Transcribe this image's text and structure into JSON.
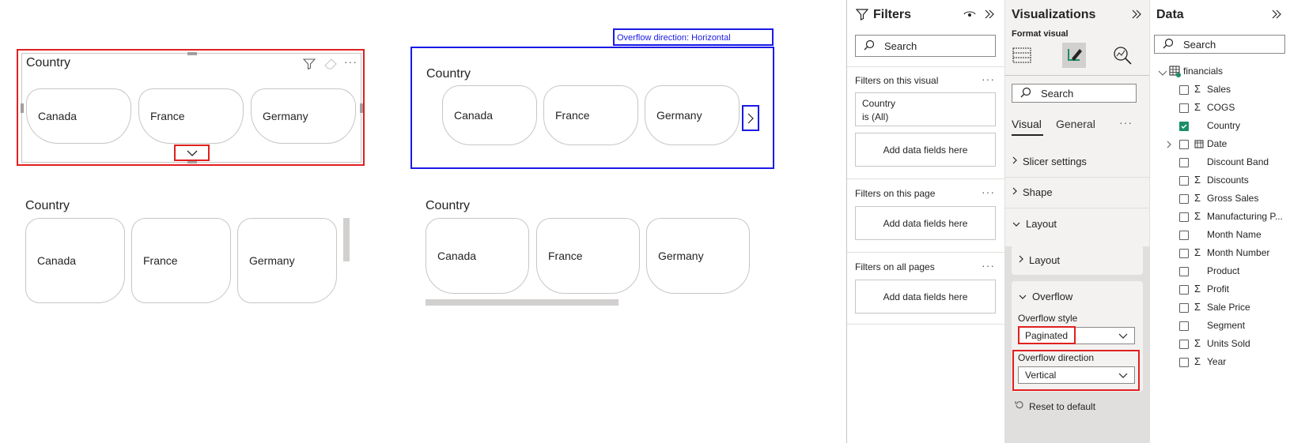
{
  "canvas": {
    "slicer1": {
      "title": "Country",
      "items": [
        "Canada",
        "France",
        "Germany"
      ]
    },
    "slicer2": {
      "title": "Country",
      "items": [
        "Canada",
        "France",
        "Germany"
      ],
      "annotation": "Overflow direction: Horizontal"
    },
    "slicer3": {
      "title": "Country",
      "items": [
        "Canada",
        "France",
        "Germany"
      ]
    },
    "slicer4": {
      "title": "Country",
      "items": [
        "Canada",
        "France",
        "Germany"
      ]
    }
  },
  "filters": {
    "title": "Filters",
    "search_placeholder": "Search",
    "on_visual_label": "Filters on this visual",
    "country_filter_name": "Country",
    "country_filter_value": "is (All)",
    "add_fields": "Add data fields here",
    "on_page_label": "Filters on this page",
    "on_all_pages_label": "Filters on all pages"
  },
  "visualizations": {
    "title": "Visualizations",
    "format_visual": "Format visual",
    "search_placeholder": "Search",
    "tab_visual": "Visual",
    "tab_general": "General",
    "slicer_settings": "Slicer settings",
    "shape": "Shape",
    "layout": "Layout",
    "layout_sub": "Layout",
    "overflow": "Overflow",
    "overflow_style_label": "Overflow style",
    "overflow_style_value": "Paginated",
    "overflow_direction_label": "Overflow direction",
    "overflow_direction_value": "Vertical",
    "reset": "Reset to default"
  },
  "data": {
    "title": "Data",
    "search_placeholder": "Search",
    "table_name": "financials",
    "fields": [
      {
        "name": "Sales",
        "sigma": true,
        "checked": false
      },
      {
        "name": "COGS",
        "sigma": true,
        "checked": false
      },
      {
        "name": "Country",
        "sigma": false,
        "checked": true
      },
      {
        "name": "Date",
        "sigma": false,
        "checked": false,
        "hierarchy": true
      },
      {
        "name": "Discount Band",
        "sigma": false,
        "checked": false
      },
      {
        "name": "Discounts",
        "sigma": true,
        "checked": false
      },
      {
        "name": "Gross Sales",
        "sigma": true,
        "checked": false
      },
      {
        "name": "Manufacturing P...",
        "sigma": true,
        "checked": false
      },
      {
        "name": "Month Name",
        "sigma": false,
        "checked": false
      },
      {
        "name": "Month Number",
        "sigma": true,
        "checked": false
      },
      {
        "name": "Product",
        "sigma": false,
        "checked": false
      },
      {
        "name": "Profit",
        "sigma": true,
        "checked": false
      },
      {
        "name": "Sale Price",
        "sigma": true,
        "checked": false
      },
      {
        "name": "Segment",
        "sigma": false,
        "checked": false
      },
      {
        "name": "Units Sold",
        "sigma": true,
        "checked": false
      },
      {
        "name": "Year",
        "sigma": true,
        "checked": false
      }
    ]
  },
  "colors": {
    "accent_red": "#e02020",
    "accent_blue": "#1a1ae6",
    "check_green": "#1a8f6a"
  }
}
